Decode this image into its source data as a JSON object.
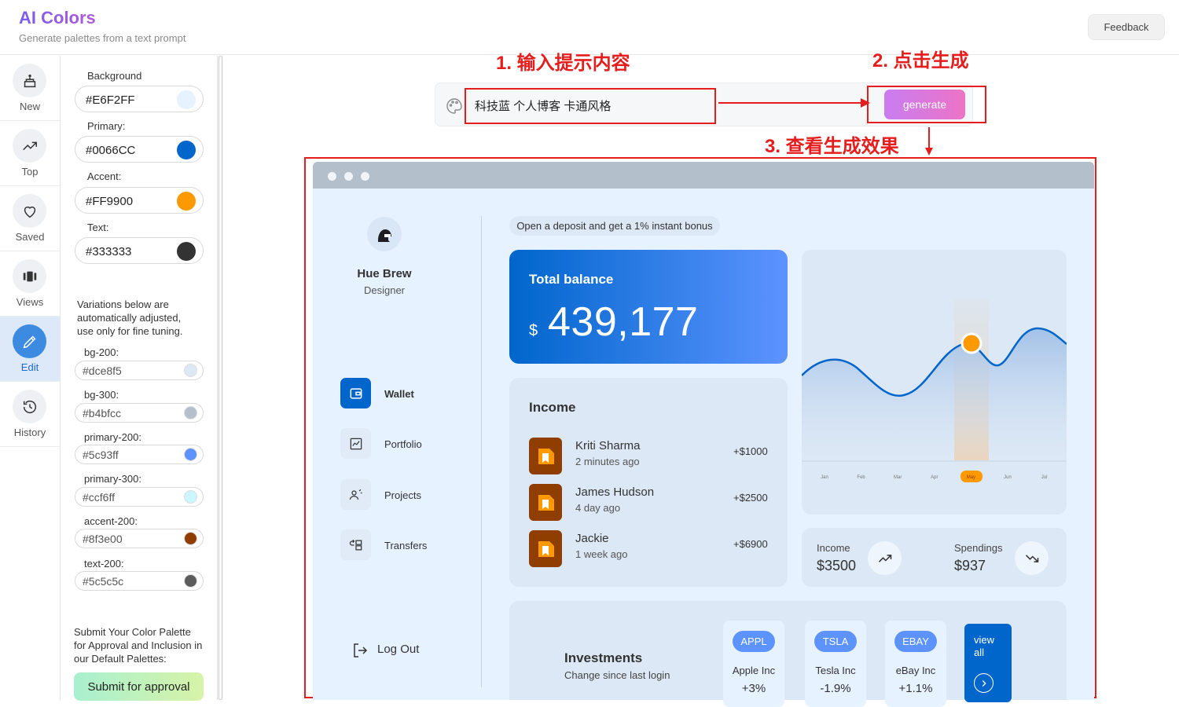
{
  "app": {
    "title": "AI Colors",
    "subtitle": "Generate palettes from a text prompt",
    "feedback": "Feedback"
  },
  "nav": {
    "items": [
      {
        "label": "New",
        "icon": "cake-icon"
      },
      {
        "label": "Top",
        "icon": "trending-up-icon"
      },
      {
        "label": "Saved",
        "icon": "heart-icon"
      },
      {
        "label": "Views",
        "icon": "carousel-icon"
      },
      {
        "label": "Edit",
        "icon": "pencil-icon",
        "active": true
      },
      {
        "label": "History",
        "icon": "history-icon"
      }
    ]
  },
  "palette": {
    "background": {
      "label": "Background",
      "value": "#E6F2FF"
    },
    "primary": {
      "label": "Primary:",
      "value": "#0066CC"
    },
    "accent": {
      "label": "Accent:",
      "value": "#FF9900"
    },
    "text": {
      "label": "Text:",
      "value": "#333333"
    },
    "note": "Variations below are automatically adjusted, use only for fine tuning.",
    "variations": [
      {
        "label": "bg-200:",
        "value": "#dce8f5"
      },
      {
        "label": "bg-300:",
        "value": "#b4bfcc"
      },
      {
        "label": "primary-200:",
        "value": "#5c93ff"
      },
      {
        "label": "primary-300:",
        "value": "#ccf6ff"
      },
      {
        "label": "accent-200:",
        "value": "#8f3e00"
      },
      {
        "label": "text-200:",
        "value": "#5c5c5c"
      }
    ],
    "submit_text": "Submit Your Color Palette for Approval and Inclusion in our Default Palettes:",
    "submit_button": "Submit for approval"
  },
  "prompt": {
    "value": "科技蓝 个人博客 卡通风格",
    "generate": "generate"
  },
  "annotations": {
    "step1": "1. 输入提示内容",
    "step2": "2. 点击生成",
    "step3": "3. 查看生成效果"
  },
  "preview": {
    "user": {
      "name": "Hue Brew",
      "role": "Designer"
    },
    "menu": [
      "Wallet",
      "Portfolio",
      "Projects",
      "Transfers"
    ],
    "logout": "Log Out",
    "promo": "Open a deposit and get a 1% instant bonus",
    "balance": {
      "title": "Total balance",
      "currency": "$",
      "amount": "439,177"
    },
    "income": {
      "title": "Income",
      "transactions": [
        {
          "name": "Kriti Sharma",
          "time": "2 minutes ago",
          "amount": "+$1000"
        },
        {
          "name": "James Hudson",
          "time": "4 day ago",
          "amount": "+$2500"
        },
        {
          "name": "Jackie",
          "time": "1 week ago",
          "amount": "+$6900"
        }
      ]
    },
    "chart": {
      "months": [
        "Jan",
        "Feb",
        "Mar",
        "Apr",
        "May",
        "Jun",
        "Jul"
      ],
      "highlight": "May"
    },
    "summary": {
      "income_label": "Income",
      "income_value": "$3500",
      "spend_label": "Spendings",
      "spend_value": "$937"
    },
    "investments": {
      "title": "Investments",
      "subtitle": "Change since last login",
      "stocks": [
        {
          "ticker": "APPL",
          "name": "Apple Inc",
          "change": "+3%"
        },
        {
          "ticker": "TSLA",
          "name": "Tesla Inc",
          "change": "-1.9%"
        },
        {
          "ticker": "EBAY",
          "name": "eBay Inc",
          "change": "+1.1%"
        }
      ],
      "view_all": "view all"
    }
  }
}
